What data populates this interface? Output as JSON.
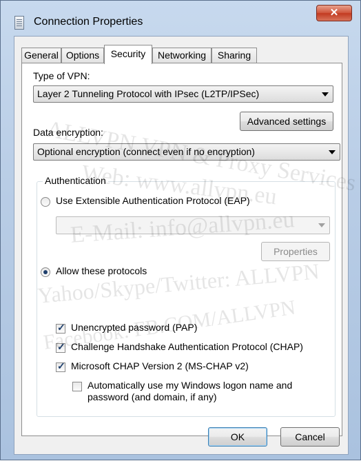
{
  "window": {
    "title": "Connection Properties",
    "close_glyph": "✕"
  },
  "tabs": [
    {
      "label": "General",
      "active": false
    },
    {
      "label": "Options",
      "active": false
    },
    {
      "label": "Security",
      "active": true
    },
    {
      "label": "Networking",
      "active": false
    },
    {
      "label": "Sharing",
      "active": false
    }
  ],
  "security": {
    "vpn_type_label": "Type of VPN:",
    "vpn_type_value": "Layer 2 Tunneling Protocol with IPsec (L2TP/IPSec)",
    "advanced_settings_label": "Advanced settings",
    "encryption_label": "Data encryption:",
    "encryption_value": "Optional encryption (connect even if no encryption)",
    "auth_group_title": "Authentication",
    "eap_radio_label": "Use Extensible Authentication Protocol (EAP)",
    "eap_radio_checked": false,
    "eap_combo_value": "",
    "properties_label": "Properties",
    "allow_radio_label": "Allow these protocols",
    "allow_radio_checked": true,
    "protocols": [
      {
        "label": "Unencrypted password (PAP)",
        "checked": true
      },
      {
        "label": "Challenge Handshake Authentication Protocol (CHAP)",
        "checked": true
      },
      {
        "label": "Microsoft CHAP Version 2 (MS-CHAP v2)",
        "checked": true
      }
    ],
    "auto_logon_label_line1": "Automatically use my Windows logon name and",
    "auto_logon_label_line2": "password (and domain, if any)",
    "auto_logon_checked": false
  },
  "buttons": {
    "ok": "OK",
    "cancel": "Cancel"
  },
  "watermark": [
    "ALLVPN VPN & Proxy Services",
    "Web: www.allvpn.eu",
    "E-Mail: info@allvpn.eu",
    "Yahoo/Skype/Twitter: ALLVPN",
    "Facebook: FB.COM/ALLVPN"
  ],
  "colors": {
    "frame": "#b9cde6",
    "close_button": "#c23a20",
    "radio_dot": "#1e3f6d"
  }
}
